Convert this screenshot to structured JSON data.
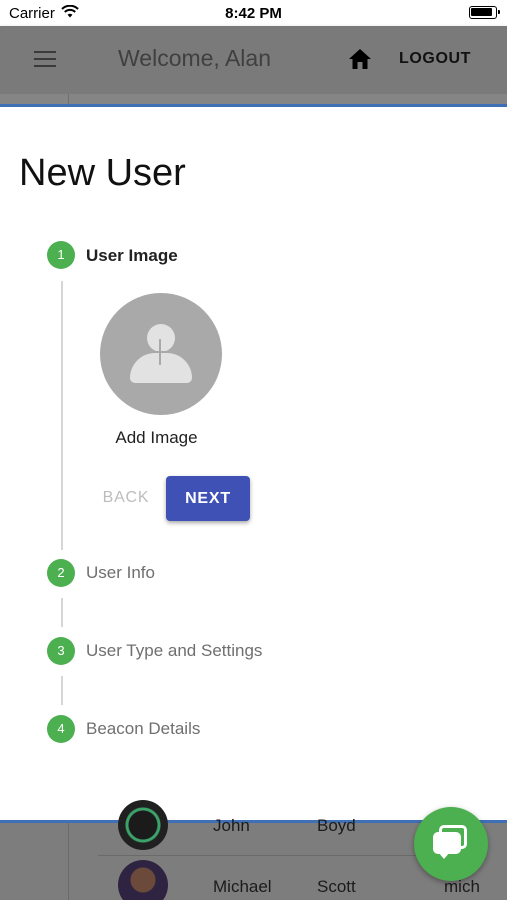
{
  "status_bar": {
    "carrier": "Carrier",
    "time": "8:42 PM",
    "icons": [
      "wifi-icon",
      "battery-icon"
    ]
  },
  "app_bar": {
    "title": "Welcome, Alan",
    "logout_label": "LOGOUT",
    "icons": [
      "menu-icon",
      "home-icon"
    ]
  },
  "modal": {
    "title": "New User",
    "steps": [
      {
        "number": "1",
        "label": "User Image",
        "active": true
      },
      {
        "number": "2",
        "label": "User Info",
        "active": false
      },
      {
        "number": "3",
        "label": "User Type and Settings",
        "active": false
      },
      {
        "number": "4",
        "label": "Beacon Details",
        "active": false
      }
    ],
    "add_image_label": "Add Image",
    "back_label": "BACK",
    "next_label": "NEXT"
  },
  "background_list": {
    "rows": [
      {
        "first": "John",
        "last": "Boyd",
        "extra": ""
      },
      {
        "first": "Michael",
        "last": "Scott",
        "extra": "mich"
      }
    ]
  },
  "colors": {
    "step_green": "#4caf50",
    "primary_blue": "#3f51b5",
    "modal_border": "#3f6fb5",
    "chat_fab": "#4caf50"
  }
}
